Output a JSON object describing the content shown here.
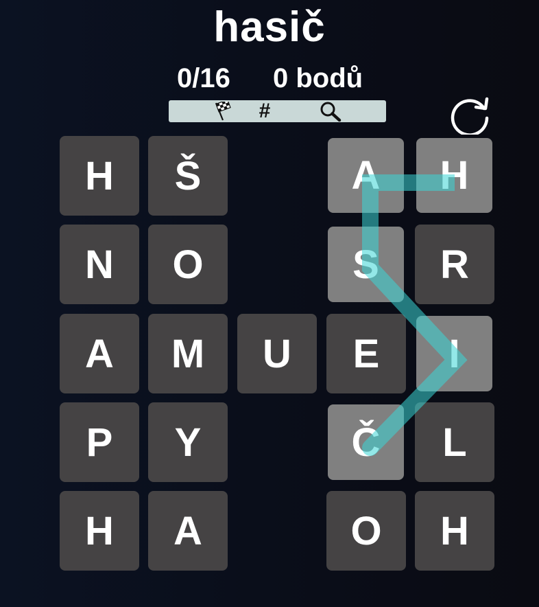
{
  "header": {
    "title": "hasič",
    "found_count": "0/16",
    "points": "0 bodů"
  },
  "toolbar": {
    "icons": [
      "checkered-flag-icon",
      "hash-icon",
      "magnifier-icon"
    ],
    "hash_glyph": "#"
  },
  "refresh_icon": "refresh-icon",
  "colors": {
    "tile": "#454344",
    "tile_selected": "#808080",
    "path": "#3ad6d6",
    "toolbar": "#c9d8d7"
  },
  "grid": [
    [
      "H",
      "Š",
      "",
      "A",
      "H"
    ],
    [
      "N",
      "O",
      "",
      "S",
      "R"
    ],
    [
      "A",
      "M",
      "U",
      "E",
      "I"
    ],
    [
      "P",
      "Y",
      "",
      "Č",
      "L"
    ],
    [
      "H",
      "A",
      "",
      "O",
      "H"
    ]
  ],
  "selected_path": [
    [
      3,
      0
    ],
    [
      4,
      0
    ],
    [
      3,
      0
    ],
    [
      3,
      1
    ],
    [
      4,
      2
    ],
    [
      3,
      3
    ]
  ],
  "selected_cells": [
    [
      0,
      3
    ],
    [
      0,
      4
    ],
    [
      1,
      3
    ],
    [
      2,
      4
    ],
    [
      3,
      3
    ]
  ]
}
